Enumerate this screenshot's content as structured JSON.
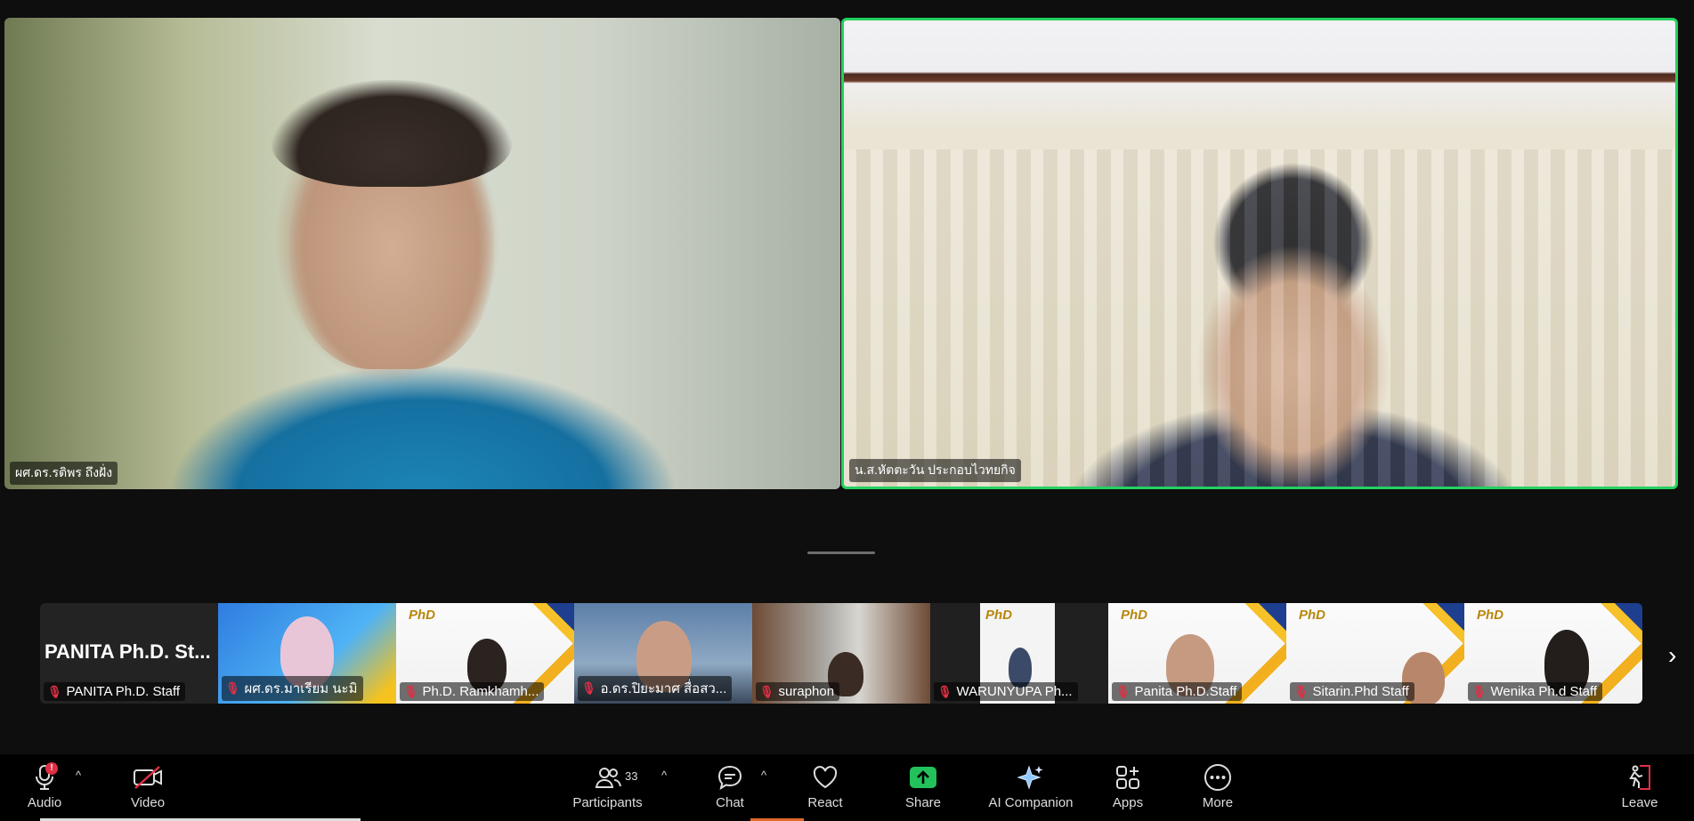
{
  "gallery": {
    "tiles": [
      {
        "name": "ผศ.ดร.รติพร ถึงฝั่ง",
        "active": false
      },
      {
        "name": "น.ส.หัตตะวัน ประกอบไวทยกิจ",
        "active": true
      }
    ]
  },
  "strip": {
    "items": [
      {
        "big_name": "PANITA Ph.D. St...",
        "label": "PANITA Ph.D. Staff",
        "muted": true
      },
      {
        "label": "ผศ.ดร.มาเรียม นะมิ",
        "muted": true
      },
      {
        "label": "Ph.D. Ramkhamh...",
        "muted": true,
        "logo": "PhD"
      },
      {
        "label": "อ.ดร.ปิยะมาศ สื่อสว...",
        "muted": true
      },
      {
        "label": "suraphon",
        "muted": true
      },
      {
        "label": "WARUNYUPA Ph...",
        "muted": true,
        "logo": "PhD"
      },
      {
        "label": "Panita Ph.D.Staff",
        "muted": true,
        "logo": "PhD"
      },
      {
        "label": "Sitarin.Phd Staff",
        "muted": true,
        "logo": "PhD"
      },
      {
        "label": "Wenika Ph.d Staff",
        "muted": true,
        "logo": "PhD"
      }
    ],
    "next_icon": "chevron-right-icon"
  },
  "toolbar": {
    "audio": {
      "label": "Audio",
      "badge": "!"
    },
    "video": {
      "label": "Video"
    },
    "participants": {
      "label": "Participants",
      "count": "33"
    },
    "chat": {
      "label": "Chat"
    },
    "react": {
      "label": "React"
    },
    "share": {
      "label": "Share"
    },
    "ai": {
      "label": "AI Companion"
    },
    "apps": {
      "label": "Apps"
    },
    "more": {
      "label": "More"
    },
    "leave": {
      "label": "Leave"
    },
    "caret": "^"
  },
  "colors": {
    "active_speaker": "#23d160",
    "share_green": "#23c15b",
    "mute_red": "#e02f44"
  }
}
